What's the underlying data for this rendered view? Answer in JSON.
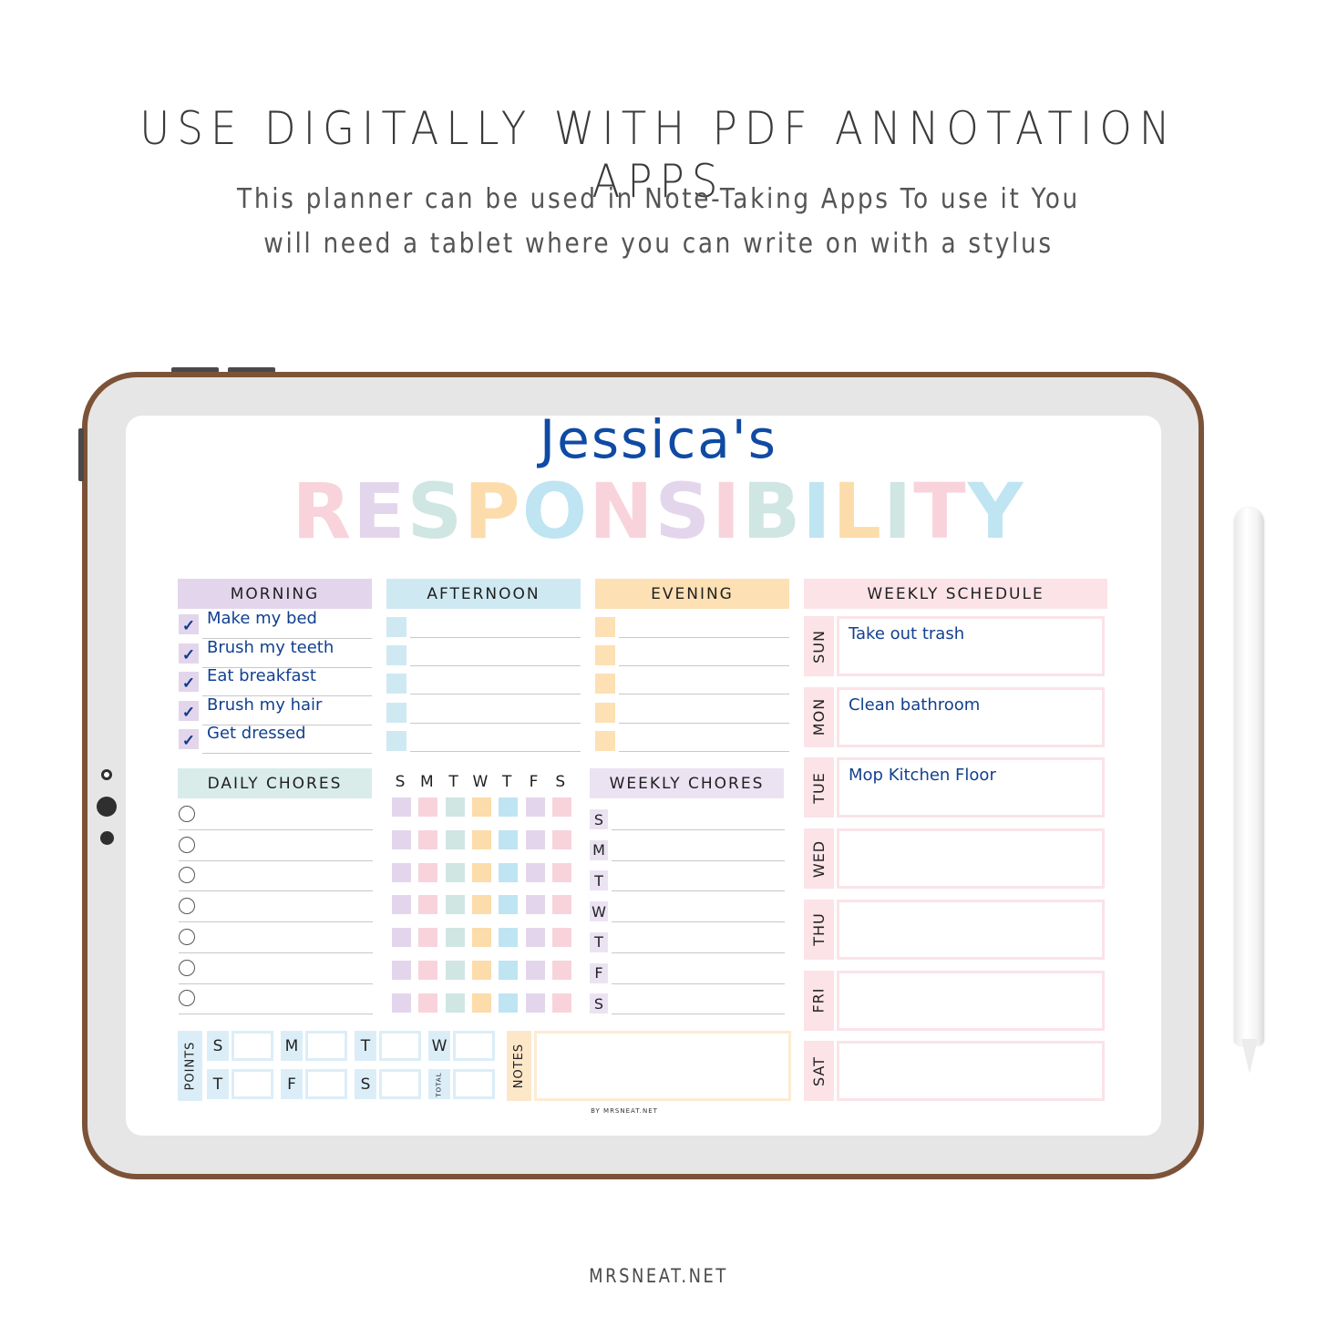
{
  "header": {
    "headline": "USE DIGITALLY WITH PDF ANNOTATION APPS",
    "subtitle_line1": "This planner can be used in Note-Taking Apps  To use it You",
    "subtitle_line2": "will need a tablet where you can write on with a stylus"
  },
  "planner": {
    "owner_name": "Jessica's",
    "title_letters": [
      "R",
      "E",
      "S",
      "P",
      "O",
      "N",
      "S",
      "I",
      "B",
      "I",
      "L",
      "I",
      "T",
      "Y"
    ],
    "title_colors": [
      "#f8d3dc",
      "#e3d6ec",
      "#cfe6e3",
      "#fcdcaa",
      "#bfe4f2",
      "#f8d3dc",
      "#e3d6ec",
      "#f8d3dc",
      "#cfe6e3",
      "#bfe4f2",
      "#fcdcaa",
      "#cfe6e3",
      "#f8d3dc",
      "#bfe4f2"
    ],
    "morning": {
      "header": "MORNING",
      "items": [
        {
          "text": "Make my bed",
          "checked": true
        },
        {
          "text": "Brush my teeth",
          "checked": true
        },
        {
          "text": "Eat breakfast",
          "checked": true
        },
        {
          "text": "Brush my hair",
          "checked": true
        },
        {
          "text": "Get dressed",
          "checked": true
        }
      ],
      "check_glyph": "✓"
    },
    "afternoon": {
      "header": "AFTERNOON",
      "rows": 5
    },
    "evening": {
      "header": "EVENING",
      "rows": 5
    },
    "daily_chores": {
      "header": "DAILY CHORES",
      "rows": 7,
      "day_letters": [
        "S",
        "M",
        "T",
        "W",
        "T",
        "F",
        "S"
      ],
      "day_colors": [
        "#e3d6ec",
        "#f8d3dc",
        "#cfe6e3",
        "#fcdcaa",
        "#bfe4f2",
        "#e3d6ec",
        "#f8d3dc"
      ]
    },
    "weekly_chores": {
      "header": "WEEKLY CHORES",
      "days": [
        "S",
        "M",
        "T",
        "W",
        "T",
        "F",
        "S"
      ]
    },
    "weekly_schedule": {
      "header": "WEEKLY SCHEDULE",
      "days": [
        {
          "day": "SUN",
          "task": "Take out trash"
        },
        {
          "day": "MON",
          "task": "Clean bathroom"
        },
        {
          "day": "TUE",
          "task": "Mop Kitchen Floor"
        },
        {
          "day": "WED",
          "task": ""
        },
        {
          "day": "THU",
          "task": ""
        },
        {
          "day": "FRI",
          "task": ""
        },
        {
          "day": "SAT",
          "task": ""
        }
      ]
    },
    "points": {
      "label": "POINTS",
      "row1": [
        "S",
        "M",
        "T",
        "W"
      ],
      "row2": [
        "T",
        "F",
        "S"
      ],
      "total_label": "TOTAL"
    },
    "notes": {
      "label": "NOTES",
      "value": ""
    },
    "byline": "BY MRSNEAT.NET"
  },
  "colors": {
    "morning": "#e3d6ec",
    "afternoon": "#cfe9f3",
    "evening": "#fde0b4",
    "weekly_schedule": "#fbe3e8",
    "daily_chores": "#d9ecea",
    "weekly_chores": "#ebe3f2",
    "points": "#dbeef8",
    "ink": "#12408f",
    "tablet_frame": "#7c5338"
  },
  "footer": {
    "site": "MRSNEAT.NET"
  }
}
